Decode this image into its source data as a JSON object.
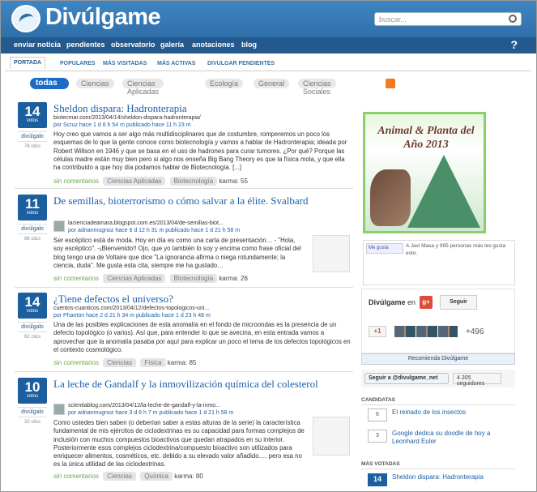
{
  "header": {
    "brand": "Divúlgame",
    "search_placeholder": "buscar..."
  },
  "nav": [
    "enviar noticia",
    "pendientes",
    "observatorio",
    "galería",
    "anotaciones",
    "blog"
  ],
  "help": "?",
  "tabs": [
    "PORTADA",
    "POPULARES",
    "MÁS VISITADAS",
    "MÁS ACTIVAS",
    "DIVULGAR PENDIENTES"
  ],
  "filters": {
    "todas": "todas",
    "items": [
      "Ciencias",
      "Ciencias Aplicadas",
      "Ecología",
      "General",
      "Ciencias Sociales"
    ]
  },
  "stories": [
    {
      "votes": "14",
      "votes_label": "votos",
      "divulgalo": "divúlgalo",
      "clicks": "76 clics",
      "title": "Sheldon dispara: Hadronterapia",
      "url": "biotecmar.com/2013/04/14/sheldon-dispara-hadronterapia/",
      "by": "por Scruz hace 1 d 6 h 54 m publicado hace 11 h 23 m",
      "body": "Hoy creo que vamos a ser algo más multidisciplinares que de costumbre, romperemos un poco los esquemas de lo que la gente conoce como biotecnología y vamos a hablar de Hadronterapia; ideada por Robert Willson en 1946 y que se basa en el uso de hadrones para curar tumores. ¿Por qué? Porque las células madre están muy bien pero si algo nos enseña Big Bang Theory es que la física mola, y que ella ha contribuido a que hoy día podamos hablar de Biotecnología. [...]",
      "comments": "sin comentarios",
      "tags": [
        "Ciencias Aplicadas",
        "Biotecnología"
      ],
      "karma": "karma: 55"
    },
    {
      "votes": "11",
      "votes_label": "votos",
      "divulgalo": "divúlgalo",
      "clicks": "86 clics",
      "title": "De semillas, bioterrorismo o cómo salvar a la élite. Svalbard",
      "url": "lacienciadeamara.blogspot.com.es/2013/04/de-semillas-biot...",
      "by": "por adrianmugnoz hace 6 d 12 h 31 m publicado hace 1 d 21 h 58 m",
      "body": "Ser escéptico está de moda. Hoy en día es como una carta de presentación… - \"Hola, soy escéptico\". -¡Bienvenido!! Ojo, que yo también lo soy y encima como frase oficial del blog tengo una de Voltaire que dice \"La ignorancia afirma o niega rotundamente; la ciencia, duda\". Me gusta esta cita, siempre me ha gustado…",
      "comments": "sin comentarios",
      "tags": [
        "Ciencias Aplicadas",
        "Biotecnología"
      ],
      "karma": "karma: 26"
    },
    {
      "votes": "14",
      "votes_label": "votos",
      "divulgalo": "divúlgalo",
      "clicks": "62 clics",
      "title": "¿Tiene defectos el universo?",
      "url": "cuentos-cuanticos.com/2013/04/12/defectos-topologicos-uni...",
      "by": "por Phanton hace 2 d 21 h 34 m publicado hace 1 d 23 h 48 m",
      "body": "Una de las posibles explicaciones de esta anomalía en el fondo de microondas es la presencia de un defecto topológico (o varios). Así que, para entender lo que se avecina, en esta entrada vamos a aprovechar que la anomalía pasaba por aquí para explicar un poco el tema de los defectos topológicos en el contexto cosmológico.",
      "comments": "sin comentarios",
      "tags": [
        "Ciencias",
        "Física"
      ],
      "karma": "karma: 85"
    },
    {
      "votes": "10",
      "votes_label": "votos",
      "divulgalo": "divúlgalo",
      "clicks": "32 clics",
      "title": "La leche de Gandalf y la inmovilización química del colesterol",
      "url": "scientiablog.com/2013/04/12/la-leche-de-gandalf-y-la-inmo...",
      "by": "por adrianmugnoz hace 3 d 6 h 7 m publicado hace 1 d 21 h 58 m",
      "body": "Como ustedes bien saben (o deberían saber a estas alturas de la serie) la característica fundamental de mis ejércitos de ciclodextrinas es su capacidad para formas complejos de inclusión con muchos compuestos bioactivos que quedan atrapados en su interior. Posteriormente esos complejos ciclodextrina/compuesto bioactivo son utilizados para enriquecer alimentos, cosméticos, etc. debido a su elevado valor añadido…. pero esa no es la única utilidad de las ciclodextrinas.",
      "comments": "sin comentarios",
      "tags": [
        "Ciencias",
        "Química"
      ],
      "karma": "karma: 80"
    }
  ],
  "sidebar": {
    "award": "Animal & Planta del Año 2013",
    "fb": {
      "like": "Me gusta",
      "text": "A Javi Masa y 995 personas más les gusta esto."
    },
    "gplus": {
      "name": "Divúlgame",
      "en": "en",
      "g": "g+",
      "follow": "Seguir",
      "plus": "+1",
      "count": "+496"
    },
    "recomienda": "Recomienda Divúlgame",
    "twitter": {
      "follow": "Seguir a @divulgame_net",
      "count": "4.305 seguidores"
    },
    "candidatas_head": "CANDIDATAS",
    "candidatas": [
      {
        "v": "6",
        "t": "El reinado de los insectos"
      },
      {
        "v": "3",
        "t": "Google dedica su doodle de hoy a Leonhard Euler"
      }
    ],
    "votadas_head": "MÁS VOTADAS",
    "votadas": [
      {
        "v": "14",
        "t": "Sheldon dispara: Hadronterapia"
      }
    ]
  },
  "colors": {
    "header": "#3f86c4",
    "nav": "#24598e",
    "vote": "#1c5f9f",
    "link": "#1b5fa8"
  }
}
